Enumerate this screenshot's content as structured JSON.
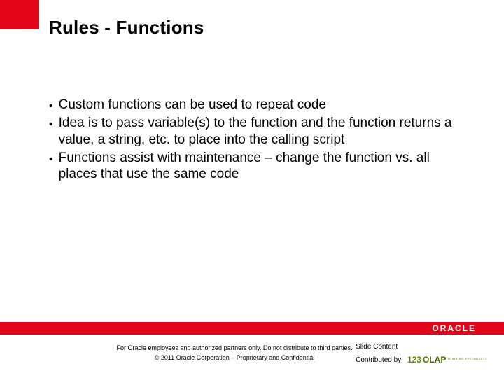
{
  "title": "Rules - Functions",
  "bullets": [
    "Custom functions can be used to repeat code",
    "Idea is to pass variable(s) to the function and the function returns a value, a string, etc. to place into the calling script",
    "Functions assist with maintenance – change the function vs. all places that use the same code"
  ],
  "brand": "ORACLE",
  "footer": {
    "line1": "For Oracle employees and authorized partners only. Do not distribute to third parties.",
    "line2": "© 2011 Oracle Corporation – Proprietary and Confidential",
    "right_line1": "Slide Content",
    "right_line2": "Contributed by:",
    "contrib_logo_left": "123",
    "contrib_logo_right": "OLAP",
    "contrib_logo_sub": "TRAINING SPECIALISTS"
  }
}
